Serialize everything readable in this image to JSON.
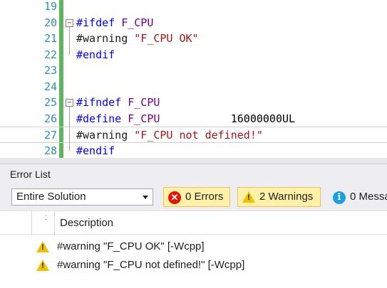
{
  "editor": {
    "lines": [
      {
        "num": "19",
        "segments": []
      },
      {
        "num": "20",
        "segments": [
          {
            "cls": "kw",
            "text": "#ifdef"
          },
          {
            "cls": "",
            "text": " "
          },
          {
            "cls": "mac",
            "text": "F_CPU"
          }
        ]
      },
      {
        "num": "21",
        "segments": [
          {
            "cls": "dir",
            "text": "#warning"
          },
          {
            "cls": "",
            "text": " "
          },
          {
            "cls": "str",
            "text": "\"F_CPU OK\""
          }
        ]
      },
      {
        "num": "22",
        "segments": [
          {
            "cls": "kw",
            "text": "#endif"
          }
        ]
      },
      {
        "num": "23",
        "segments": []
      },
      {
        "num": "24",
        "segments": []
      },
      {
        "num": "25",
        "segments": [
          {
            "cls": "kw",
            "text": "#ifndef"
          },
          {
            "cls": "",
            "text": " "
          },
          {
            "cls": "mac",
            "text": "F_CPU"
          }
        ]
      },
      {
        "num": "26",
        "segments": [
          {
            "cls": "kw",
            "text": "#define"
          },
          {
            "cls": "",
            "text": " "
          },
          {
            "cls": "mac",
            "text": "F_CPU"
          },
          {
            "cls": "num",
            "text": "           16000000UL"
          }
        ]
      },
      {
        "num": "27",
        "segments": [
          {
            "cls": "dir",
            "text": "#warning"
          },
          {
            "cls": "",
            "text": " "
          },
          {
            "cls": "str",
            "text": "\"F_CPU not defined!\""
          }
        ]
      },
      {
        "num": "28",
        "segments": [
          {
            "cls": "kw",
            "text": "#endif"
          }
        ]
      }
    ],
    "fold_markers": [
      "20",
      "25"
    ],
    "current_line": "27"
  },
  "error_list": {
    "title": "Error List",
    "scope": "Entire Solution",
    "errors_label": "0 Errors",
    "warnings_label": "2 Warnings",
    "messages_label": "0 Messa",
    "column_description": "Description",
    "rows": [
      {
        "icon": "warning-icon",
        "text": "#warning \"F_CPU OK\" [-Wcpp]"
      },
      {
        "icon": "warning-icon",
        "text": "#warning \"F_CPU not defined!\" [-Wcpp]"
      }
    ]
  },
  "colors": {
    "keyword": "#0000ff",
    "macro": "#6f008a",
    "string": "#a31515",
    "line_number": "#2b91af",
    "change_bar": "#5db55d",
    "warning": "#f0c000",
    "error": "#e51400",
    "info": "#1ba1e2"
  }
}
